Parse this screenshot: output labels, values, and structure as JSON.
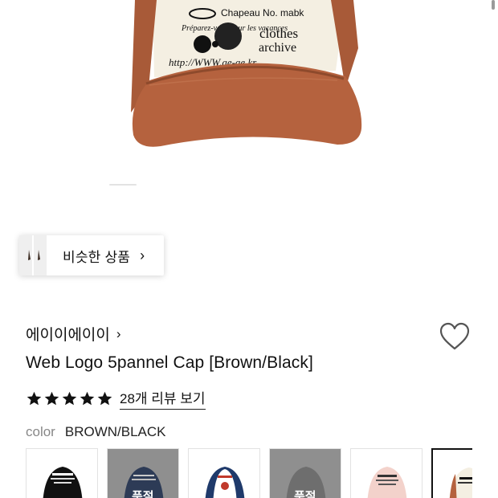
{
  "hero": {
    "image_name": "cap-product-photo",
    "cap_texts": [
      "Chapeau No. mabk",
      "Préparez-vous pour les vacances",
      "clothes",
      "archive",
      "http://WWW.ae-ae.kr"
    ],
    "colors": {
      "crown": "#f4efe2",
      "brim": "#b5623e",
      "embroidery": "#111111"
    }
  },
  "similar": {
    "label": "비슷한 상품",
    "chevron": "›"
  },
  "brand": {
    "name": "에이이에이이",
    "chevron": "›"
  },
  "product": {
    "title": "Web Logo 5pannel Cap [Brown/Black]"
  },
  "rating": {
    "stars": 5,
    "max": 5,
    "review_link": "28개 리뷰 보기"
  },
  "color": {
    "label": "color",
    "value": "BROWN/BLACK"
  },
  "swatches": [
    {
      "name": "black",
      "crown": "#111111",
      "soldout": false,
      "sold_label": ""
    },
    {
      "name": "navy",
      "crown": "#2d3b56",
      "soldout": true,
      "sold_label": "품절"
    },
    {
      "name": "navy-white",
      "crown": "#ffffff",
      "soldout": false,
      "sold_label": ""
    },
    {
      "name": "grey",
      "crown": "#6e6e6e",
      "soldout": true,
      "sold_label": "품절"
    },
    {
      "name": "pink",
      "crown": "#f3d2cb",
      "soldout": false,
      "sold_label": ""
    },
    {
      "name": "brown-black",
      "crown": "#f4efe2",
      "soldout": false,
      "sold_label": "",
      "selected": true
    }
  ],
  "accent": {
    "text": "#111111",
    "muted": "#888888",
    "heart_stroke": "#555555",
    "star": "#111111"
  }
}
